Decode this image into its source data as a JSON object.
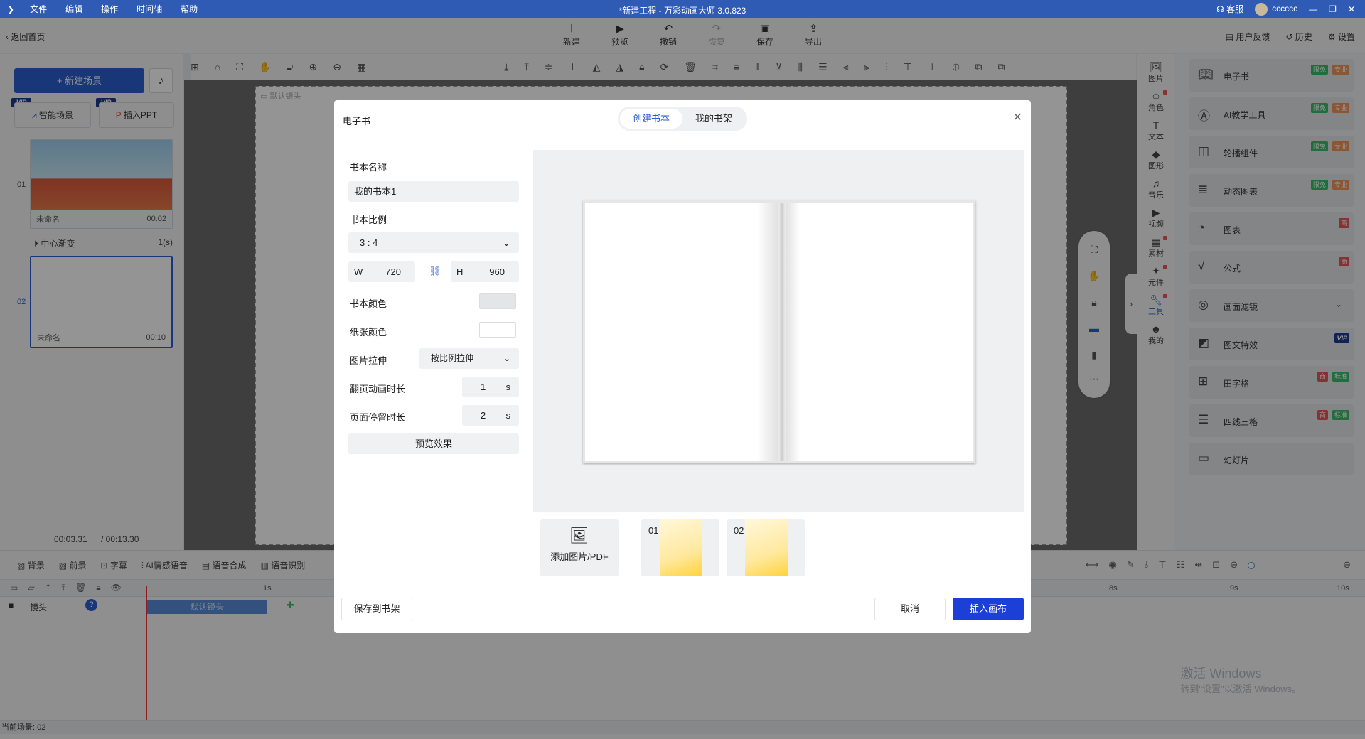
{
  "titlebar": {
    "menu": [
      "文件",
      "编辑",
      "操作",
      "时间轴",
      "帮助"
    ],
    "title": "*新建工程 - 万彩动画大师 3.0.823",
    "service": "客服",
    "user": "cccccc"
  },
  "toolbar": {
    "back": "返回首页",
    "buttons": [
      {
        "label": "新建",
        "icon": "＋",
        "disabled": false
      },
      {
        "label": "预览",
        "icon": "▶",
        "disabled": false
      },
      {
        "label": "撤销",
        "icon": "↶",
        "disabled": false
      },
      {
        "label": "恢复",
        "icon": "↷",
        "disabled": true
      },
      {
        "label": "保存",
        "icon": "▣",
        "disabled": false
      },
      {
        "label": "导出",
        "icon": "⇪",
        "disabled": false
      }
    ],
    "right": [
      "用户反馈",
      "历史",
      "设置"
    ]
  },
  "leftpanel": {
    "new_scene": "+ 新建场景",
    "smart_scene": "智能场景",
    "insert_ppt": "插入PPT",
    "vip": "VIP",
    "scenes": [
      {
        "num": "01",
        "name": "未命名",
        "time": "00:02"
      },
      {
        "num": "02",
        "name": "未命名",
        "time": "00:10"
      }
    ],
    "transition": {
      "name": "中心渐变",
      "dur": "1(s)"
    },
    "time_current": "00:03.31",
    "time_total": "/ 00:13.30"
  },
  "canvas": {
    "lens_label": "默认镜头"
  },
  "rstrip": [
    "图片",
    "角色",
    "文本",
    "图形",
    "音乐",
    "视频",
    "素材",
    "元件",
    "工具",
    "我的"
  ],
  "tools": [
    {
      "label": "电子书",
      "tags": [
        [
          "限免",
          "g"
        ],
        [
          "专业",
          "o"
        ]
      ]
    },
    {
      "label": "AI教学工具",
      "tags": [
        [
          "限免",
          "g"
        ],
        [
          "专业",
          "o"
        ]
      ]
    },
    {
      "label": "轮播组件",
      "tags": [
        [
          "限免",
          "g"
        ],
        [
          "专业",
          "o"
        ]
      ]
    },
    {
      "label": "动态图表",
      "tags": [
        [
          "限免",
          "g"
        ],
        [
          "专业",
          "o"
        ]
      ]
    },
    {
      "label": "图表",
      "tags": [
        [
          "商",
          "r"
        ]
      ]
    },
    {
      "label": "公式",
      "tags": [
        [
          "商",
          "r"
        ]
      ]
    },
    {
      "label": "画面滤镜",
      "tags": []
    },
    {
      "label": "图文特效",
      "tags": [
        [
          "VIP",
          "v"
        ]
      ]
    },
    {
      "label": "田字格",
      "tags": [
        [
          "商",
          "r"
        ],
        [
          "标准",
          "g"
        ]
      ]
    },
    {
      "label": "四线三格",
      "tags": [
        [
          "商",
          "r"
        ],
        [
          "标准",
          "g"
        ]
      ]
    },
    {
      "label": "幻灯片",
      "tags": []
    }
  ],
  "timeline": {
    "tabs": [
      "背景",
      "前景",
      "字幕",
      "AI情感语音",
      "语音合成",
      "语音识别"
    ],
    "ruler": [
      "1s",
      "8s",
      "9s",
      "10s"
    ],
    "track_label": "镜头",
    "lens": "默认镜头",
    "status": "当前场景: 02",
    "watermark1": "激活 Windows",
    "watermark2": "转到\"设置\"以激活 Windows。"
  },
  "dialog": {
    "title": "电子书",
    "tab_create": "创建书本",
    "tab_shelf": "我的书架",
    "name_label": "书本名称",
    "name_value": "我的书本1",
    "ratio_label": "书本比例",
    "ratio_value": "3 : 4",
    "w_label": "W",
    "w_value": "720",
    "h_label": "H",
    "h_value": "960",
    "book_color_label": "书本颜色",
    "book_color": "#e4e5e7",
    "paper_color_label": "纸张颜色",
    "paper_color": "#ffffff",
    "stretch_label": "图片拉伸",
    "stretch_value": "按比例拉伸",
    "flip_label": "翻页动画时长",
    "flip_value": "1",
    "stay_label": "页面停留时长",
    "stay_value": "2",
    "unit": "s",
    "preview_btn": "预览效果",
    "add_pages": "添加图片/PDF",
    "pages": [
      "01",
      "02"
    ],
    "save_shelf": "保存到书架",
    "cancel": "取消",
    "insert": "插入画布",
    "accent": "#1c3fd8"
  }
}
